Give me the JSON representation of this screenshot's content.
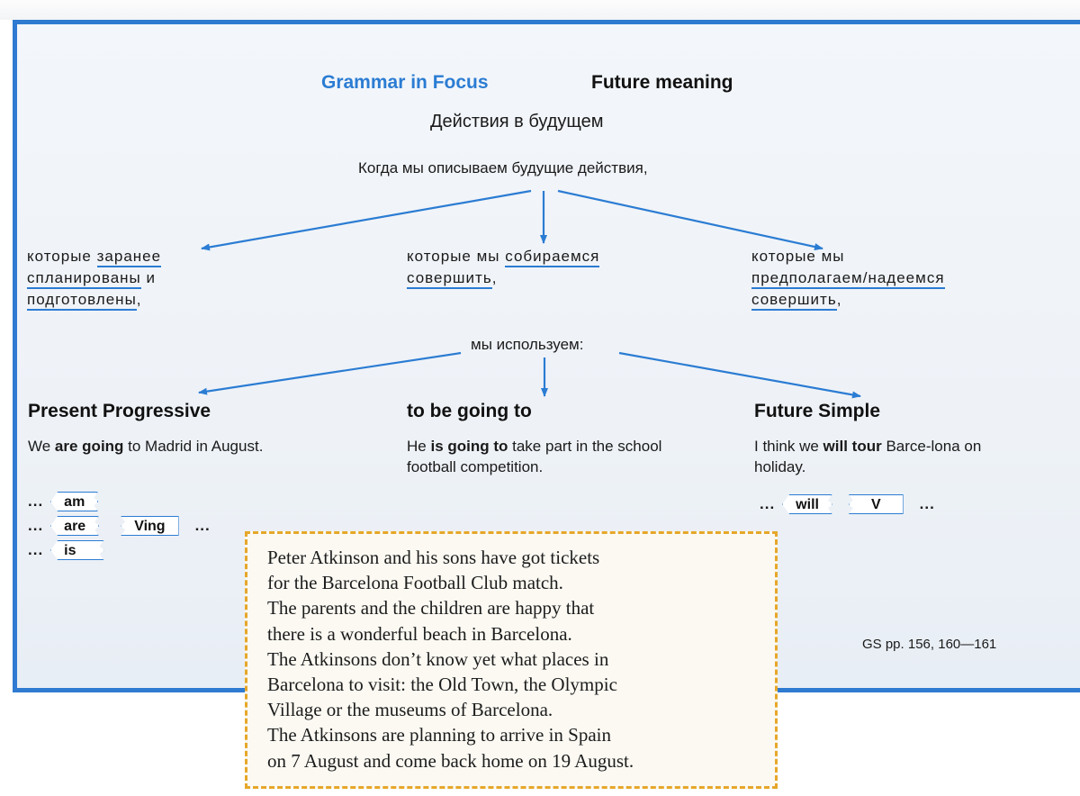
{
  "header": {
    "section_label": "Grammar in Focus",
    "topic": "Future meaning",
    "subtitle": "Действия в будущем",
    "intro": "Когда мы описываем будущие действия,"
  },
  "branches": [
    {
      "condition_parts": [
        {
          "text": "которые ",
          "underline": false
        },
        {
          "text": "заранее",
          "underline": true
        }
      ],
      "condition_line2": [
        {
          "text": "спланированы",
          "underline": true
        },
        {
          "text": " и",
          "underline": false
        }
      ],
      "condition_line3": [
        {
          "text": "подготовлены",
          "underline": true
        },
        {
          "text": ",",
          "underline": false
        }
      ],
      "tense": "Present Progressive",
      "example_before": "We ",
      "example_bold": "are going",
      "example_after": " to Madrid in August.",
      "formula": {
        "rows": [
          {
            "prefix": "...",
            "aux": "am"
          },
          {
            "prefix": "...",
            "aux": "are",
            "main": "Ving",
            "suffix": "..."
          },
          {
            "prefix": "...",
            "aux": "is"
          }
        ]
      }
    },
    {
      "condition_line1": [
        {
          "text": "которые мы ",
          "underline": false
        },
        {
          "text": "собираемся",
          "underline": true
        }
      ],
      "condition_line2": [
        {
          "text": "совершить",
          "underline": true
        },
        {
          "text": ",",
          "underline": false
        }
      ],
      "tense": "to be going to",
      "example_before": "He ",
      "example_bold": "is going to",
      "example_after": " take part in the school football competition."
    },
    {
      "condition_line1": [
        {
          "text": "которые мы",
          "underline": false
        }
      ],
      "condition_line2": [
        {
          "text": "предполагаем/надеемся",
          "underline": true
        }
      ],
      "condition_line3": [
        {
          "text": "совершить",
          "underline": true
        },
        {
          "text": ",",
          "underline": false
        }
      ],
      "tense": "Future Simple",
      "example_before": "I think we ",
      "example_bold": "will tour",
      "example_after": " Barce-lona on holiday.",
      "formula": {
        "prefix": "...",
        "aux": "will",
        "main": "V",
        "suffix": "..."
      }
    }
  ],
  "middle_connector": "мы используем:",
  "reference": "GS pp. 156, 160—161",
  "note_box": {
    "lines": [
      "Peter Atkinson and his sons have got tickets",
      "for the Barcelona Football Club match.",
      "The parents and the children are happy that",
      "there is a wonderful beach in Barcelona.",
      "The Atkinsons don’t know yet what places in",
      "Barcelona to visit: the Old Town, the Olympic",
      "Village or the museums of Barcelona.",
      "The Atkinsons are planning to arrive in Spain",
      "on 7 August and come back home on 19 August."
    ]
  },
  "colors": {
    "accent_blue": "#2b7cd3",
    "note_border": "#e6a72a"
  }
}
